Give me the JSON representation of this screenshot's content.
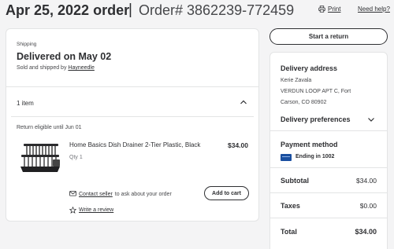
{
  "header": {
    "order_date": "Apr 25, 2022 order",
    "separator": "|",
    "order_number": "Order# 3862239-772459",
    "print_label": "Print",
    "help_label": "Need help?"
  },
  "shipment": {
    "section_label": "Shipping",
    "status": "Delivered on May 02",
    "sold_prefix": "Sold and shipped by",
    "seller": "Hayneedle",
    "items_count": "1 item",
    "return_eligibility": "Return eligible until Jun 01"
  },
  "product": {
    "name": "Home Basics Dish Drainer 2-Tier Plastic, Black",
    "price": "$34.00",
    "qty": "Qty 1",
    "contact_link": "Contact seller",
    "contact_suffix": "to ask about your order",
    "add_to_cart": "Add to cart",
    "review_link": "Write a review"
  },
  "actions": {
    "start_return": "Start a return"
  },
  "summary": {
    "delivery_address_title": "Delivery address",
    "address_name": "Kerie Zavala",
    "address_line1": "VERDUN LOOP APT C, Fort",
    "address_line2": "Carson, CO 80902",
    "delivery_preferences_title": "Delivery preferences",
    "payment_method_title": "Payment method",
    "card_ending": "Ending in 1002",
    "subtotal_label": "Subtotal",
    "subtotal_value": "$34.00",
    "taxes_label": "Taxes",
    "taxes_value": "$0.00",
    "total_label": "Total",
    "total_value": "$34.00"
  },
  "colors": {
    "background": "#f4f4f5",
    "card": "#ffffff",
    "text": "#2e2f32",
    "card_icon": "#1a4fa0"
  },
  "icons": [
    "print-icon",
    "chevron-up-icon",
    "chevron-down-icon",
    "message-icon",
    "star-icon",
    "credit-card-icon"
  ]
}
